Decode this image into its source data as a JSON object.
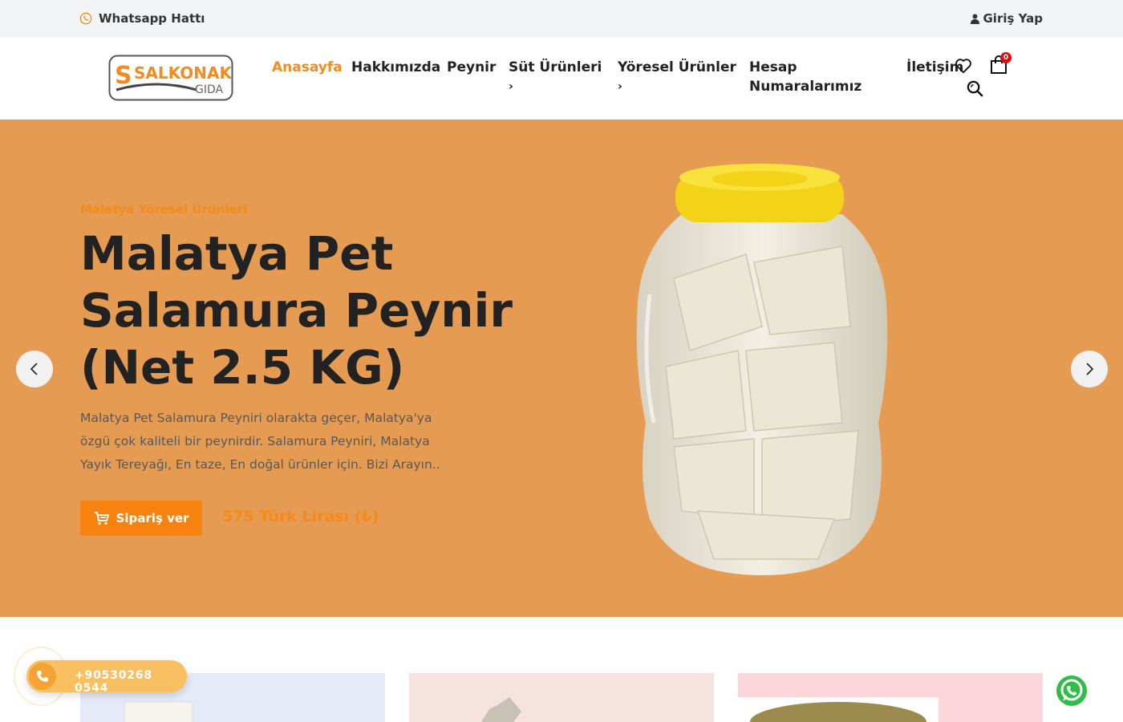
{
  "topbar": {
    "whatsapp_label": "Whatsapp Hattı",
    "login_label": "Giriş Yap"
  },
  "header": {
    "logo_text_main": "SALKONAK",
    "logo_text_sub": "GIDA",
    "nav": [
      {
        "label": "Anasayfa",
        "active": true
      },
      {
        "label": "Hakkımızda"
      },
      {
        "label": "Peynir"
      },
      {
        "label": "Süt Ürünleri",
        "submenu": "›"
      },
      {
        "label": "Yöresel Ürünler",
        "submenu": "›"
      },
      {
        "label_line1": "Hesap",
        "label_line2": "Numaralarımız"
      },
      {
        "label": "İletişim"
      }
    ],
    "cart_count": "0"
  },
  "hero": {
    "subtitle": "Malatya Yöresel Ürünleri",
    "title_line1": "Malatya Pet",
    "title_line2": "Salamura Peynir",
    "title_line3": "(Net 2.5 KG)",
    "description": "Malatya Pet Salamura Peyniri olarakta geçer, Malatya'ya özgü çok kaliteli bir peynirdir. Salamura Peyniri, Malatya Yayık Tereyağı, En taze, En doğal ürünler için. Bizi Arayın..",
    "order_button": "Sipariş ver",
    "price": "575 Türk Lirası (₺)",
    "background_color": "#e59b52",
    "accent_color": "#f8820f"
  },
  "floating": {
    "phone_number": "+90530268 0544"
  },
  "icons": {
    "whatsapp": "whatsapp-icon",
    "user": "user-icon",
    "heart": "heart-icon",
    "cart": "shopping-bag-icon",
    "search": "search-icon",
    "prev": "chevron-left-icon",
    "next": "chevron-right-icon",
    "phone": "phone-icon"
  }
}
